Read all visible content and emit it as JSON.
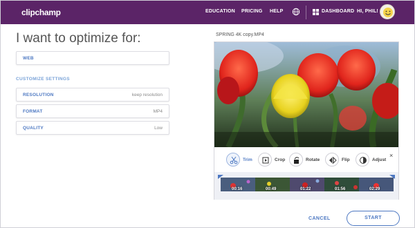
{
  "header": {
    "logo": "clipchamp",
    "nav": [
      "EDUCATION",
      "PRICING",
      "HELP"
    ],
    "globe_icon": "globe-icon",
    "dashboard_label": "DASHBOARD",
    "greeting": "HI, PHIL!"
  },
  "left": {
    "heading": "I want to optimize for:",
    "target": "WEB",
    "customize_label": "CUSTOMIZE SETTINGS",
    "settings": [
      {
        "label": "RESOLUTION",
        "value": "keep resolution"
      },
      {
        "label": "FORMAT",
        "value": "MP4"
      },
      {
        "label": "QUALITY",
        "value": "Low"
      }
    ]
  },
  "video": {
    "filename": "SPRING 4K copy.MP4",
    "tools": [
      {
        "label": "Trim",
        "icon": "scissors-icon"
      },
      {
        "label": "Crop",
        "icon": "crop-icon"
      },
      {
        "label": "Rotate",
        "icon": "rotate-icon"
      },
      {
        "label": "Flip",
        "icon": "flip-icon"
      },
      {
        "label": "Adjust",
        "icon": "adjust-icon"
      }
    ],
    "close": "×",
    "timestamps": [
      "00:16",
      "00:49",
      "01:22",
      "01:56",
      "02:29"
    ]
  },
  "actions": {
    "cancel": "CANCEL",
    "start": "START"
  },
  "colors": {
    "header_bg": "#5b2467",
    "accent": "#4d78c2"
  }
}
